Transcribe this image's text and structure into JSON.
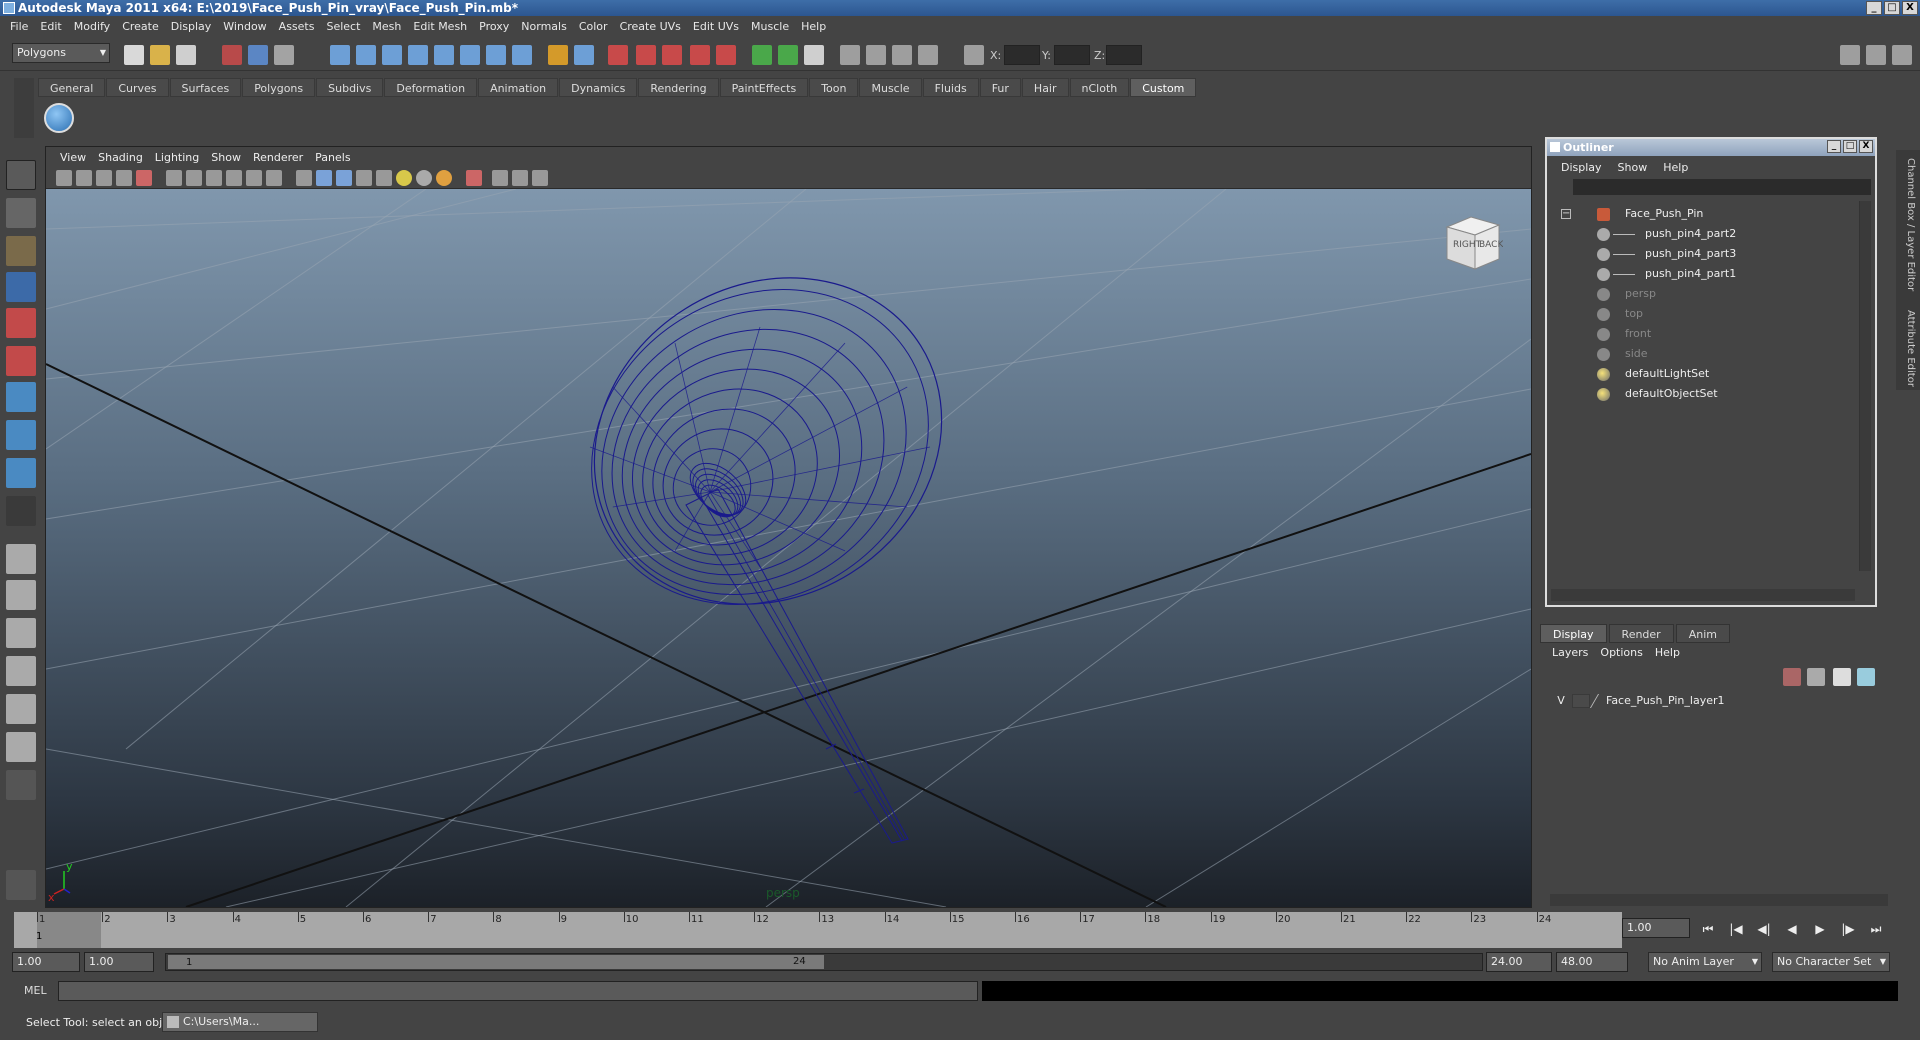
{
  "window": {
    "title": "Autodesk Maya 2011 x64: E:\\2019\\Face_Push_Pin_vray\\Face_Push_Pin.mb*",
    "btn_min": "_",
    "btn_max": "□",
    "btn_close": "X"
  },
  "menubar": [
    "File",
    "Edit",
    "Modify",
    "Create",
    "Display",
    "Window",
    "Assets",
    "Select",
    "Mesh",
    "Edit Mesh",
    "Proxy",
    "Normals",
    "Color",
    "Create UVs",
    "Edit UVs",
    "Muscle",
    "Help"
  ],
  "statusline": {
    "mode": "Polygons",
    "x_label": "X:",
    "y_label": "Y:",
    "z_label": "Z:"
  },
  "shelf": {
    "tabs": [
      "General",
      "Curves",
      "Surfaces",
      "Polygons",
      "Subdivs",
      "Deformation",
      "Animation",
      "Dynamics",
      "Rendering",
      "PaintEffects",
      "Toon",
      "Muscle",
      "Fluids",
      "Fur",
      "Hair",
      "nCloth",
      "Custom"
    ],
    "active_tab": "Custom"
  },
  "viewport": {
    "menus": [
      "View",
      "Shading",
      "Lighting",
      "Show",
      "Renderer",
      "Panels"
    ],
    "camera_label": "persp",
    "viewcube_right": "RIGHT",
    "viewcube_back": "BACK",
    "axis_y": "y",
    "axis_x": "x",
    "wire_color": "#1a1a8c"
  },
  "outliner": {
    "title": "Outliner",
    "menus": [
      "Display",
      "Show",
      "Help"
    ],
    "expander": "−",
    "items": [
      {
        "label": "Face_Push_Pin"
      },
      {
        "label": "push_pin4_part2"
      },
      {
        "label": "push_pin4_part3"
      },
      {
        "label": "push_pin4_part1"
      },
      {
        "label": "persp"
      },
      {
        "label": "top"
      },
      {
        "label": "front"
      },
      {
        "label": "side"
      },
      {
        "label": "defaultLightSet"
      },
      {
        "label": "defaultObjectSet"
      }
    ]
  },
  "sidetabs": {
    "channel_box": "Channel Box / Layer Editor",
    "attribute_editor": "Attribute Editor"
  },
  "layers": {
    "tabs": [
      "Display",
      "Render",
      "Anim"
    ],
    "active_tab": "Display",
    "menus": [
      "Layers",
      "Options",
      "Help"
    ],
    "row": {
      "visibility": "V",
      "name": "Face_Push_Pin_layer1"
    }
  },
  "timeline": {
    "ticks": [
      "1",
      "2",
      "3",
      "4",
      "5",
      "6",
      "7",
      "8",
      "9",
      "10",
      "11",
      "12",
      "13",
      "14",
      "15",
      "16",
      "17",
      "18",
      "19",
      "20",
      "21",
      "22",
      "23",
      "24"
    ],
    "current_frame": "1",
    "current_frame_field": "1.00"
  },
  "playback": {
    "goto_start": "⏮",
    "step_back_key": "|◀",
    "step_back": "◀|",
    "play_back": "◀",
    "play_fwd": "▶",
    "step_fwd": "|▶",
    "goto_end": "⏭"
  },
  "range": {
    "start_time": "1.00",
    "playback_start": "1.00",
    "slider_start": "1",
    "slider_end": "24",
    "playback_end": "24.00",
    "end_time": "48.00",
    "anim_layer": "No Anim Layer",
    "character_set": "No Character Set"
  },
  "commandline": {
    "label": "MEL"
  },
  "helpline": {
    "text": "Select Tool: select an object",
    "task_label": "C:\\Users\\Ma..."
  }
}
